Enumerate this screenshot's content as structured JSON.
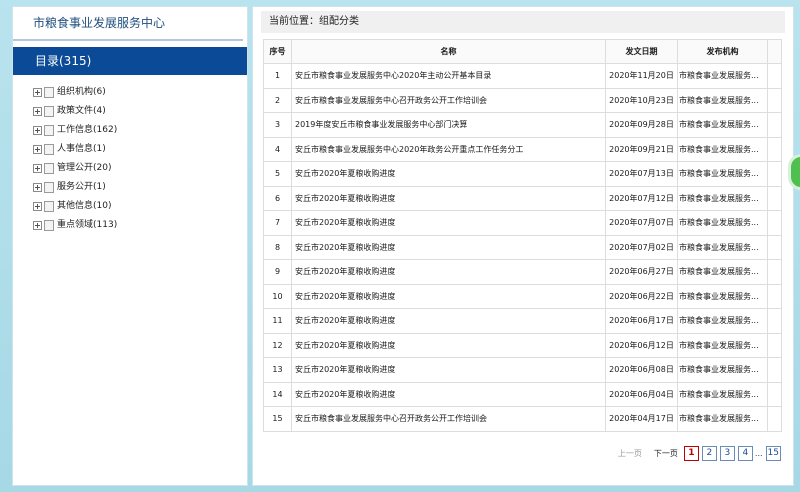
{
  "sidebar": {
    "org_title": "市粮食事业发展服务中心",
    "catalog": "目录(315)",
    "items": [
      {
        "label": "组织机构(6)"
      },
      {
        "label": "政策文件(4)"
      },
      {
        "label": "工作信息(162)"
      },
      {
        "label": "人事信息(1)"
      },
      {
        "label": "管理公开(20)"
      },
      {
        "label": "服务公开(1)"
      },
      {
        "label": "其他信息(10)"
      },
      {
        "label": "重点领域(113)"
      }
    ]
  },
  "main": {
    "breadcrumb": "当前位置：组配分类",
    "columns": [
      "序号",
      "名称",
      "发文日期",
      "发布机构"
    ],
    "rows": [
      {
        "no": "1",
        "title": "安丘市粮食事业发展服务中心2020年主动公开基本目录",
        "date": "2020年11月20日",
        "publisher": "市粮食事业发展服务..."
      },
      {
        "no": "2",
        "title": "安丘市粮食事业发展服务中心召开政务公开工作培训会",
        "date": "2020年10月23日",
        "publisher": "市粮食事业发展服务..."
      },
      {
        "no": "3",
        "title": "2019年度安丘市粮食事业发展服务中心部门决算",
        "date": "2020年09月28日",
        "publisher": "市粮食事业发展服务..."
      },
      {
        "no": "4",
        "title": "安丘市粮食事业发展服务中心2020年政务公开重点工作任务分工",
        "date": "2020年09月21日",
        "publisher": "市粮食事业发展服务..."
      },
      {
        "no": "5",
        "title": "安丘市2020年夏粮收购进度",
        "date": "2020年07月13日",
        "publisher": "市粮食事业发展服务..."
      },
      {
        "no": "6",
        "title": "安丘市2020年夏粮收购进度",
        "date": "2020年07月12日",
        "publisher": "市粮食事业发展服务..."
      },
      {
        "no": "7",
        "title": "安丘市2020年夏粮收购进度",
        "date": "2020年07月07日",
        "publisher": "市粮食事业发展服务..."
      },
      {
        "no": "8",
        "title": "安丘市2020年夏粮收购进度",
        "date": "2020年07月02日",
        "publisher": "市粮食事业发展服务..."
      },
      {
        "no": "9",
        "title": "安丘市2020年夏粮收购进度",
        "date": "2020年06月27日",
        "publisher": "市粮食事业发展服务..."
      },
      {
        "no": "10",
        "title": "安丘市2020年夏粮收购进度",
        "date": "2020年06月22日",
        "publisher": "市粮食事业发展服务..."
      },
      {
        "no": "11",
        "title": "安丘市2020年夏粮收购进度",
        "date": "2020年06月17日",
        "publisher": "市粮食事业发展服务..."
      },
      {
        "no": "12",
        "title": "安丘市2020年夏粮收购进度",
        "date": "2020年06月12日",
        "publisher": "市粮食事业发展服务..."
      },
      {
        "no": "13",
        "title": "安丘市2020年夏粮收购进度",
        "date": "2020年06月08日",
        "publisher": "市粮食事业发展服务..."
      },
      {
        "no": "14",
        "title": "安丘市2020年夏粮收购进度",
        "date": "2020年06月04日",
        "publisher": "市粮食事业发展服务..."
      },
      {
        "no": "15",
        "title": "安丘市粮食事业发展服务中心召开政务公开工作培训会",
        "date": "2020年04月17日",
        "publisher": "市粮食事业发展服务..."
      }
    ],
    "pager": {
      "prev": "上一页",
      "next": "下一页",
      "pages": [
        "1",
        "2",
        "3",
        "4"
      ],
      "current": "1",
      "ellipsis": "...",
      "last": "15"
    }
  },
  "colors": {
    "catalog_bg": "#0a4a96",
    "background": "#a9dbe8",
    "current_page": "#c00000"
  },
  "icons": [
    "plus-icon",
    "folder-icon"
  ]
}
